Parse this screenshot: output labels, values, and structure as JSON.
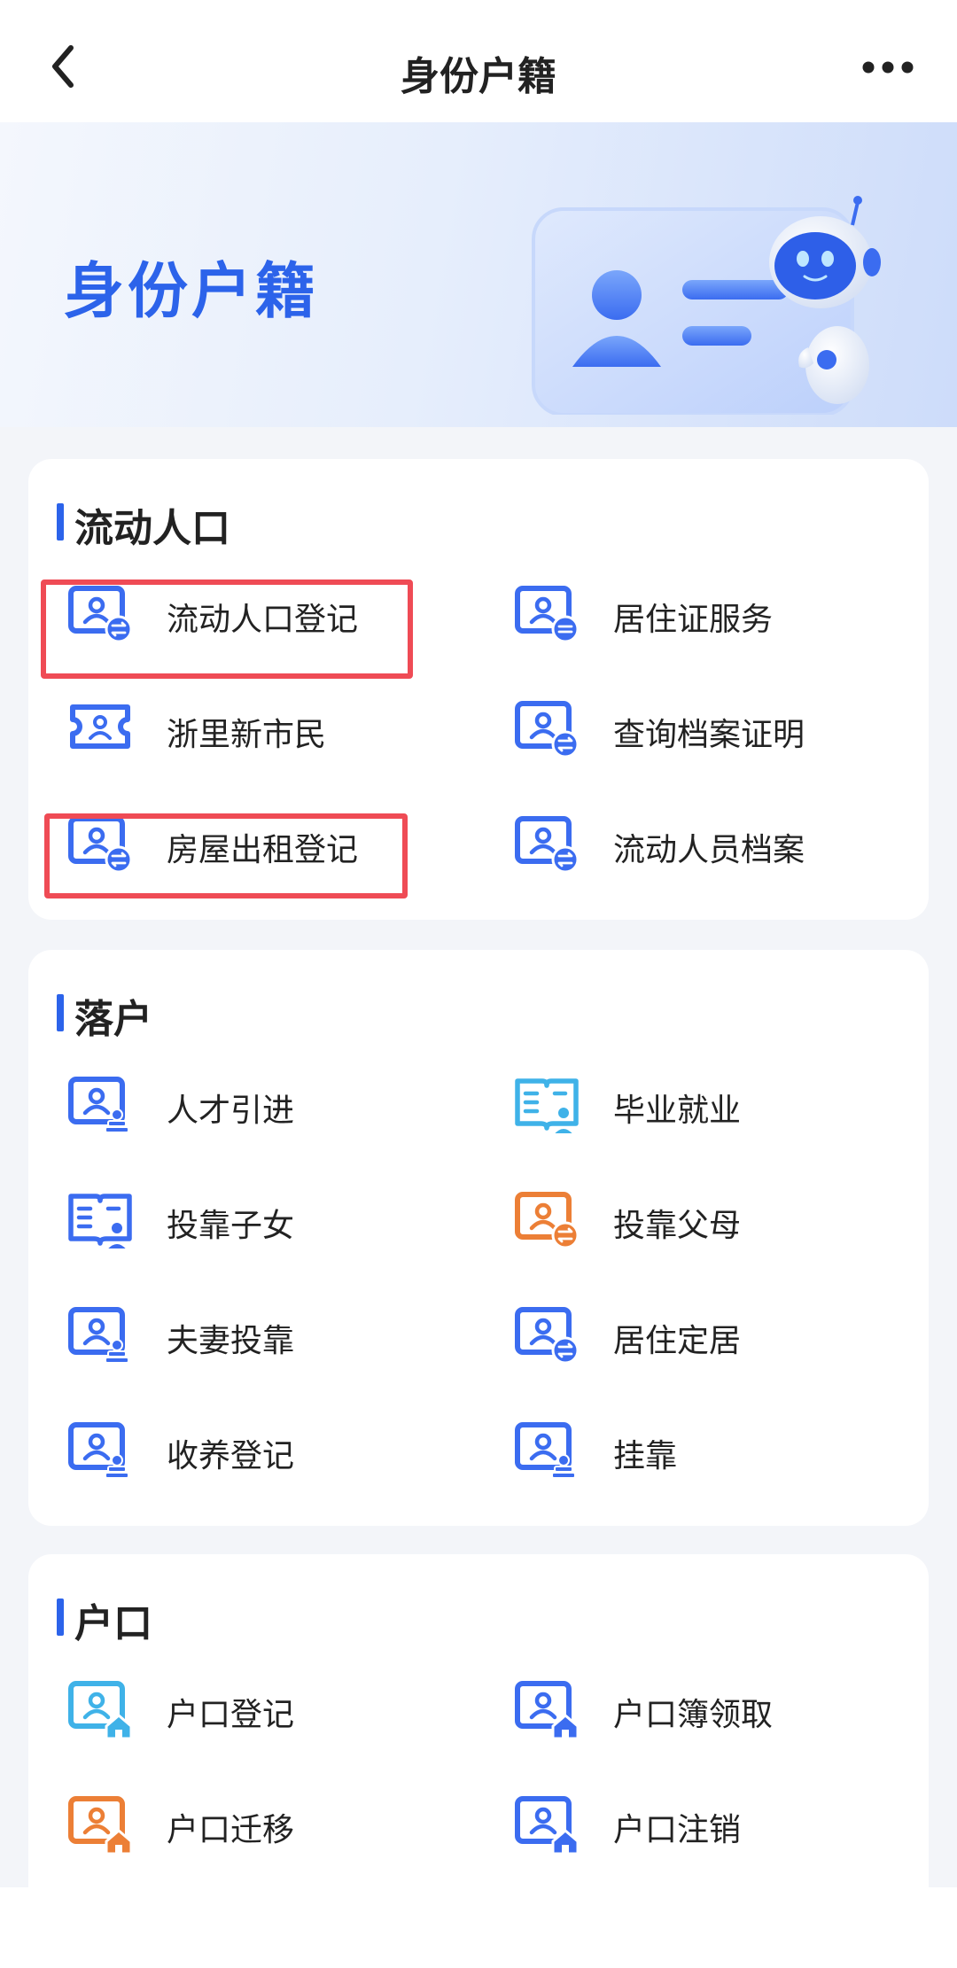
{
  "navbar": {
    "title": "身份户籍",
    "back_icon": "chevron-left-icon",
    "more_icon": "more-dots-icon"
  },
  "banner": {
    "title": "身份户籍",
    "art": "id-card-robot-illustration"
  },
  "sections": [
    {
      "title": "流动人口",
      "items": [
        {
          "label": "流动人口登记",
          "icon": "id-card-transfer-icon",
          "highlighted": true
        },
        {
          "label": "居住证服务",
          "icon": "id-card-minus-icon"
        },
        {
          "label": "浙里新市民",
          "icon": "ticket-person-icon"
        },
        {
          "label": "查询档案证明",
          "icon": "id-card-transfer-icon"
        },
        {
          "label": "房屋出租登记",
          "icon": "id-card-transfer-icon",
          "highlighted": true
        },
        {
          "label": "流动人员档案",
          "icon": "id-card-transfer-icon"
        }
      ]
    },
    {
      "title": "落户",
      "items": [
        {
          "label": "人才引进",
          "icon": "id-card-stamp-icon"
        },
        {
          "label": "毕业就业",
          "icon": "book-person-icon"
        },
        {
          "label": "投靠子女",
          "icon": "book-person-icon"
        },
        {
          "label": "投靠父母",
          "icon": "id-card-transfer-icon"
        },
        {
          "label": "夫妻投靠",
          "icon": "id-card-stamp-icon"
        },
        {
          "label": "居住定居",
          "icon": "id-card-transfer-icon"
        },
        {
          "label": "收养登记",
          "icon": "id-card-stamp-icon"
        },
        {
          "label": "挂靠",
          "icon": "id-card-stamp-icon"
        }
      ]
    },
    {
      "title": "户口",
      "items": [
        {
          "label": "户口登记",
          "icon": "id-card-house-icon"
        },
        {
          "label": "户口簿领取",
          "icon": "id-card-house-icon"
        },
        {
          "label": "户口迁移",
          "icon": "id-card-house-icon"
        },
        {
          "label": "户口注销",
          "icon": "id-card-house-icon"
        }
      ]
    }
  ],
  "colors": {
    "accent": "#2c63ea",
    "highlight": "#ef4b55",
    "icon_orange": "#f08a3c",
    "icon_cyan": "#4fc3ea",
    "page_bg": "#f3f5f9"
  }
}
